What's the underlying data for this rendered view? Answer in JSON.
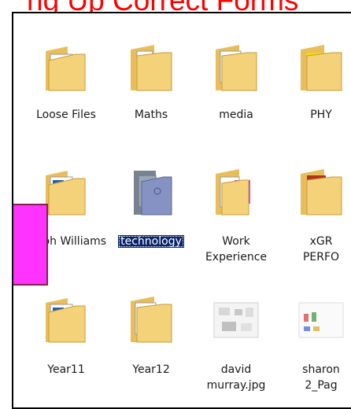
{
  "banner": {
    "text": "ng Up Correct Forms"
  },
  "items": [
    {
      "label": "Loose Files",
      "icon": "folder-with-documents-icon"
    },
    {
      "label": "Maths",
      "icon": "folder-icon"
    },
    {
      "label": "media",
      "icon": "folder-with-document-icon"
    },
    {
      "label": "PHY",
      "icon": "folder-icon"
    },
    {
      "label": "steph Williams",
      "icon": "folder-with-documents-icon"
    },
    {
      "label": "technology",
      "icon": "folder-icon",
      "selected": true
    },
    {
      "label_line1": "Work",
      "label_line2": "Experience",
      "icon": "folder-with-document-icon"
    },
    {
      "label_line1": "xGR",
      "label_line2": "PERFO",
      "icon": "folder-icon"
    },
    {
      "label": "Year11",
      "icon": "folder-with-documents-icon"
    },
    {
      "label": "Year12",
      "icon": "folder-with-document-icon"
    },
    {
      "label_line1": "david",
      "label_line2": "murray.jpg",
      "icon": "image-file-icon"
    },
    {
      "label_line1": "sharon",
      "label_line2": "2_Pag",
      "icon": "image-file-icon"
    }
  ],
  "colors": {
    "banner": "#ff0000",
    "arrow": "#ff33ff",
    "selection": "#0a246a",
    "folder": "#f3d27a"
  }
}
